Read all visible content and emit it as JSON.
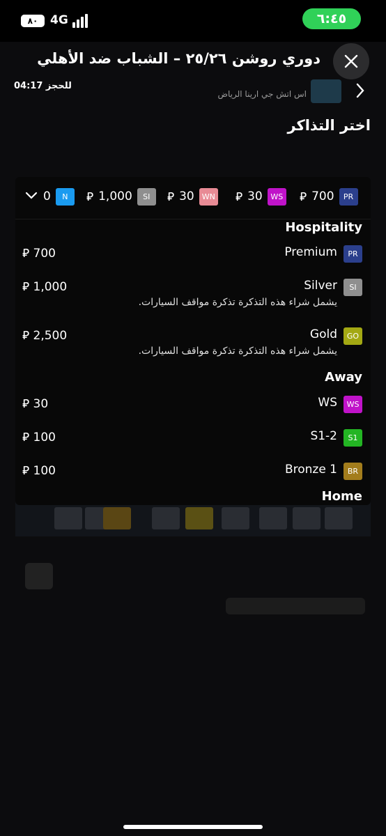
{
  "status_bar": {
    "battery_level": "٨٠",
    "battery_fraction": 0.8,
    "network": "4G",
    "time": "٦:٤٥",
    "time_pill_color": "#30d158"
  },
  "header": {
    "title": "دوري روشن ٢٥/٢٦ – الشباب ضد الأهلي",
    "close_icon": "close-icon"
  },
  "event": {
    "countdown": "04:17 للحجز",
    "venue": "اس اتش جي ارينا الرياض"
  },
  "section_title": "اختر التذاكر",
  "currency": "⃁",
  "filter_chips": [
    {
      "code": "PR",
      "price": "700",
      "color": "#2b3f8c"
    },
    {
      "code": "WS",
      "price": "30",
      "color": "#c013c9"
    },
    {
      "code": "WN",
      "price": "30",
      "color": "#e88b95"
    },
    {
      "code": "SI",
      "price": "1,000",
      "color": "#8f8f8f"
    },
    {
      "code": "N",
      "price": "0",
      "color": "#1a9bf0"
    }
  ],
  "groups": {
    "hospitality": {
      "label": "Hospitality",
      "tiers": [
        {
          "code": "PR",
          "name": "Premium",
          "price": "700",
          "color": "#2b3f8c",
          "note": ""
        },
        {
          "code": "SI",
          "name": "Silver",
          "price": "1,000",
          "color": "#8f8f8f",
          "note": "يشمل شراء هذه التذكرة تذكرة مواقف السيارات."
        },
        {
          "code": "GO",
          "name": "Gold",
          "price": "2,500",
          "color": "#a3a813",
          "note": "يشمل شراء هذه التذكرة تذكرة مواقف السيارات."
        }
      ]
    },
    "away": {
      "label": "Away",
      "tiers": [
        {
          "code": "WS",
          "name": "WS",
          "price": "30",
          "color": "#c013c9"
        },
        {
          "code": "S1",
          "name": "S1-2",
          "price": "100",
          "color": "#23b523"
        },
        {
          "code": "BR",
          "name": "Bronze 1",
          "price": "100",
          "color": "#a37d1c"
        }
      ]
    },
    "home": {
      "label": "Home"
    }
  }
}
